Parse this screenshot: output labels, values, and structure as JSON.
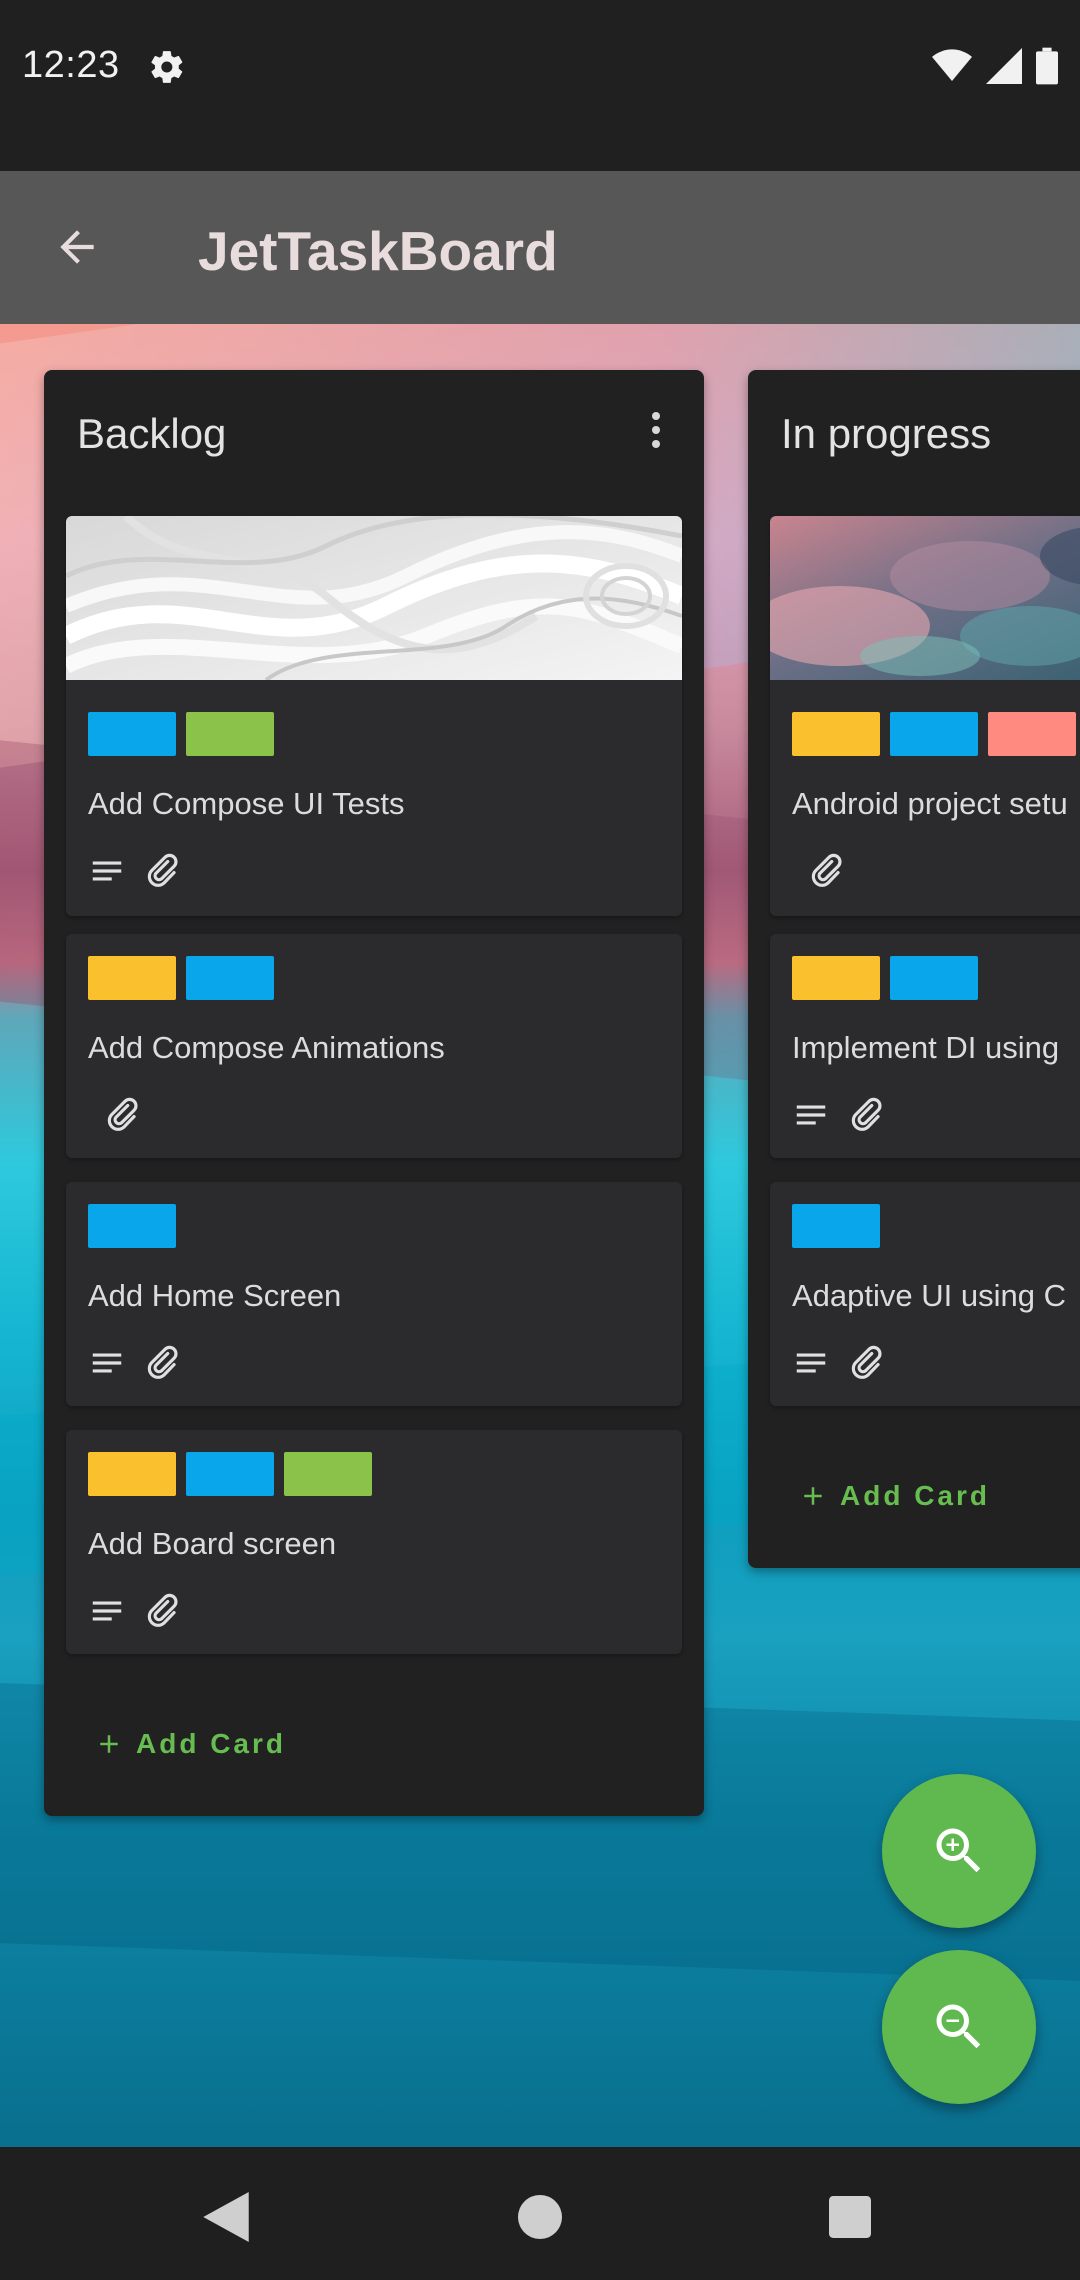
{
  "status_bar": {
    "time": "12:23",
    "icons": [
      "gear-icon",
      "wifi-icon",
      "signal-icon",
      "battery-icon"
    ]
  },
  "app_bar": {
    "title": "JetTaskBoard",
    "back_icon": "arrow-back-icon"
  },
  "columns": [
    {
      "title": "Backlog",
      "menu_icon": "more-vert-icon",
      "add_card_label": "Add Card",
      "cards": [
        {
          "title": "Add Compose UI Tests",
          "cover": "paper-stack-image",
          "labels": [
            "#0aa6ec",
            "#8bc34a"
          ],
          "icons": [
            "description-icon",
            "attachment-icon"
          ]
        },
        {
          "title": "Add Compose Animations",
          "labels": [
            "#fbc02d",
            "#0aa6ec"
          ],
          "icons": [
            "attachment-icon"
          ]
        },
        {
          "title": "Add Home Screen",
          "labels": [
            "#0aa6ec"
          ],
          "icons": [
            "description-icon",
            "attachment-icon"
          ]
        },
        {
          "title": "Add Board screen",
          "labels": [
            "#fbc02d",
            "#0aa6ec",
            "#8bc34a"
          ],
          "icons": [
            "description-icon",
            "attachment-icon"
          ]
        }
      ]
    },
    {
      "title": "In progress",
      "add_card_label": "Add Card",
      "cards": [
        {
          "title": "Android project setu",
          "cover": "smoke-image",
          "labels": [
            "#fbc02d",
            "#0aa6ec",
            "#ff8a80"
          ],
          "icons": [
            "attachment-icon"
          ]
        },
        {
          "title": "Implement DI using",
          "labels": [
            "#fbc02d",
            "#0aa6ec"
          ],
          "icons": [
            "description-icon",
            "attachment-icon"
          ]
        },
        {
          "title": "Adaptive UI using C",
          "labels": [
            "#0aa6ec"
          ],
          "icons": [
            "description-icon",
            "attachment-icon"
          ]
        }
      ]
    }
  ],
  "fabs": {
    "zoom_in_icon": "zoom-in-icon",
    "zoom_out_icon": "zoom-out-icon"
  },
  "nav_bar": {
    "icons": [
      "nav-back-icon",
      "nav-home-icon",
      "nav-recents-icon"
    ]
  },
  "colors": {
    "accent_green": "#67bd50",
    "fab_green": "#5fb94f",
    "label_blue": "#0aa6ec",
    "label_green": "#8bc34a",
    "label_yellow": "#fbc02d",
    "label_red": "#ff8a80"
  }
}
